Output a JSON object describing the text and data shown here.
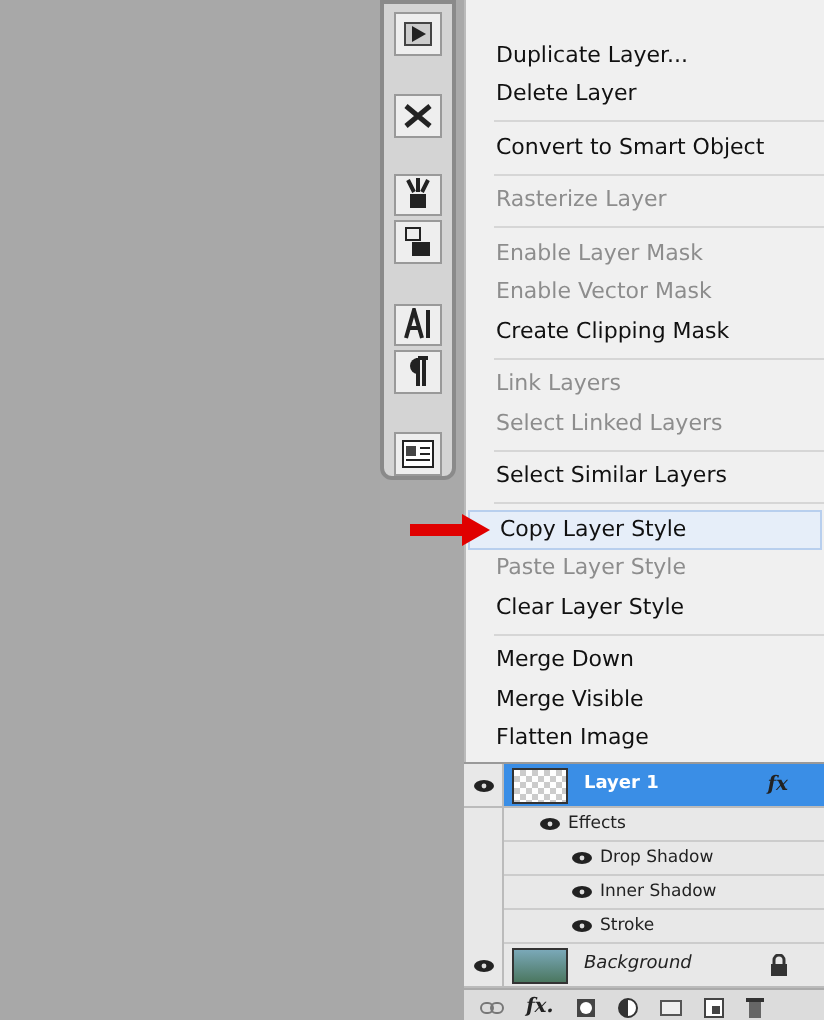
{
  "menu": {
    "items": [
      {
        "kind": "item",
        "label": "Duplicate Layer...",
        "disabled": false,
        "selected": false
      },
      {
        "kind": "item",
        "label": "Delete Layer",
        "disabled": false,
        "selected": false
      },
      {
        "kind": "separator"
      },
      {
        "kind": "item",
        "label": "Convert to Smart Object",
        "disabled": false,
        "selected": false
      },
      {
        "kind": "separator"
      },
      {
        "kind": "item",
        "label": "Rasterize Layer",
        "disabled": true,
        "selected": false
      },
      {
        "kind": "separator"
      },
      {
        "kind": "item",
        "label": "Enable Layer Mask",
        "disabled": true,
        "selected": false
      },
      {
        "kind": "item",
        "label": "Enable Vector Mask",
        "disabled": true,
        "selected": false
      },
      {
        "kind": "item",
        "label": "Create Clipping Mask",
        "disabled": false,
        "selected": false
      },
      {
        "kind": "separator"
      },
      {
        "kind": "item",
        "label": "Link Layers",
        "disabled": true,
        "selected": false
      },
      {
        "kind": "item",
        "label": "Select Linked Layers",
        "disabled": true,
        "selected": false
      },
      {
        "kind": "separator"
      },
      {
        "kind": "item",
        "label": "Select Similar Layers",
        "disabled": false,
        "selected": false
      },
      {
        "kind": "separator"
      },
      {
        "kind": "item",
        "label": "Copy Layer Style",
        "disabled": false,
        "selected": true
      },
      {
        "kind": "item",
        "label": "Paste Layer Style",
        "disabled": true,
        "selected": false
      },
      {
        "kind": "item",
        "label": "Clear Layer Style",
        "disabled": false,
        "selected": false
      },
      {
        "kind": "separator"
      },
      {
        "kind": "item",
        "label": "Merge Down",
        "disabled": false,
        "selected": false
      },
      {
        "kind": "item",
        "label": "Merge Visible",
        "disabled": false,
        "selected": false
      },
      {
        "kind": "item",
        "label": "Flatten Image",
        "disabled": false,
        "selected": false
      }
    ]
  },
  "layers": {
    "rows": [
      {
        "kind": "layer",
        "name": "Layer 1",
        "fx": "fx",
        "selected": true,
        "transparent": true
      },
      {
        "kind": "effects",
        "name": "Effects"
      },
      {
        "kind": "effect",
        "name": "Drop Shadow"
      },
      {
        "kind": "effect",
        "name": "Inner Shadow"
      },
      {
        "kind": "effect",
        "name": "Stroke"
      },
      {
        "kind": "layer",
        "name": "Background",
        "selected": false,
        "locked": true,
        "transparent": false
      }
    ],
    "footer_fx": "fx."
  }
}
